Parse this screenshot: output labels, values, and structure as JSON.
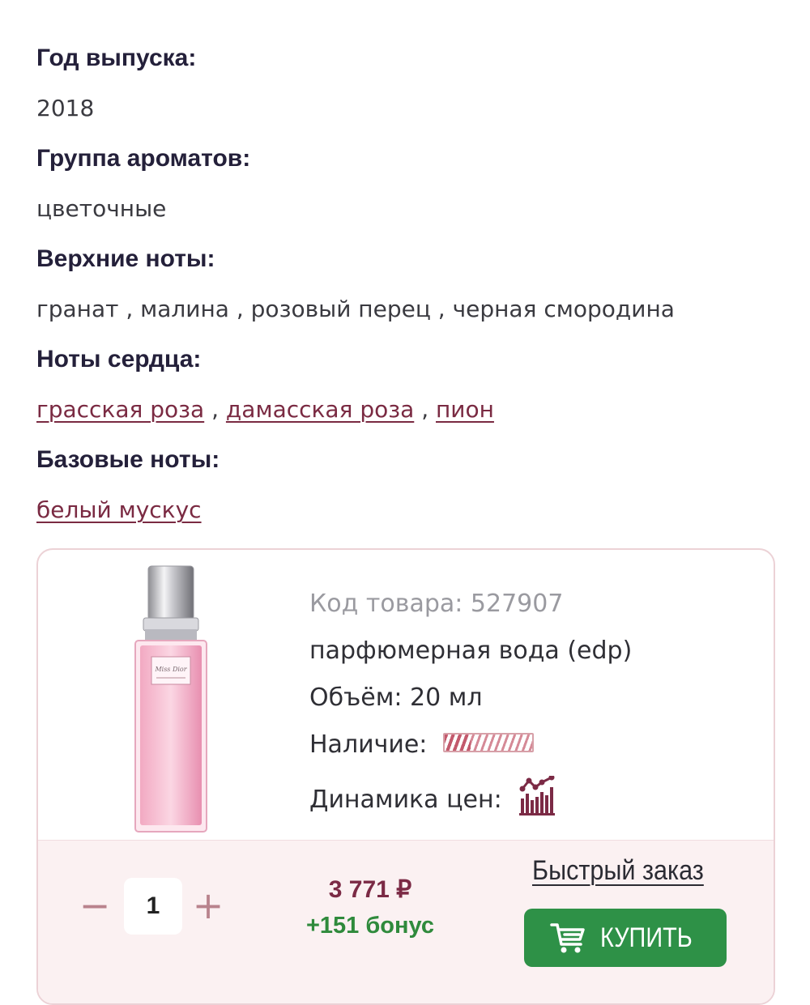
{
  "specs": {
    "year_label": "Год выпуска:",
    "year_value": "2018",
    "group_label": "Группа ароматов:",
    "group_value": "цветочные",
    "top_label": "Верхние ноты:",
    "top_value": "гранат , малина , розовый перец , черная смородина",
    "heart_label": "Ноты сердца:",
    "heart_notes": [
      "грасская роза",
      "дамасская роза",
      "пион"
    ],
    "heart_sep": ",",
    "base_label": "Базовые ноты:",
    "base_notes": [
      "белый мускус"
    ]
  },
  "product": {
    "code_text": "Код товара: 527907",
    "type_text": "парфюмерная вода (edp)",
    "volume_text": "Объём: 20 мл",
    "availability_label": "Наличие:",
    "price_dynamics_label": "Динамика цен:",
    "availability_level": 0.3,
    "image_icon": "perfume-bottle-image",
    "chart_icon": "price-chart-icon"
  },
  "order": {
    "minus_label": "−",
    "plus_label": "+",
    "quantity": "1",
    "price": "3 771 ₽",
    "bonus": "+151 бонус",
    "quick_order_label": "Быстрый заказ",
    "buy_label": "КУПИТЬ",
    "cart_icon": "cart-icon"
  },
  "colors": {
    "accent": "#7b2a45",
    "buy_green": "#2e9147",
    "bonus_green": "#2f8a3c",
    "card_border": "#ecd2d6"
  }
}
